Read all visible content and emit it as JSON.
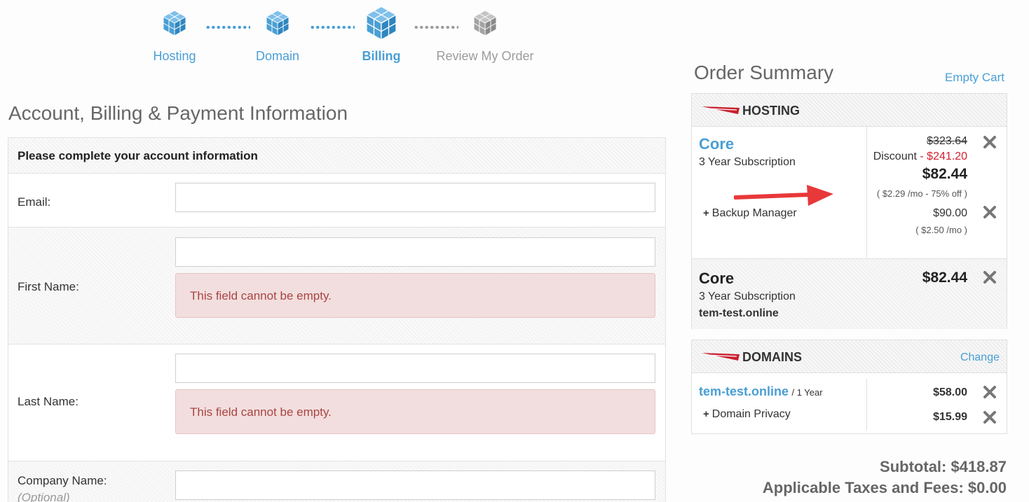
{
  "steps": [
    {
      "label": "Hosting",
      "state": "done"
    },
    {
      "label": "Domain",
      "state": "done"
    },
    {
      "label": "Billing",
      "state": "active"
    },
    {
      "label": "Review My Order",
      "state": "inactive"
    }
  ],
  "form": {
    "title": "Account, Billing & Payment Information",
    "panel_heading": "Please complete your account information",
    "fields": {
      "email": {
        "label": "Email:",
        "value": ""
      },
      "first_name": {
        "label": "First Name:",
        "value": "",
        "error": "This field cannot be empty."
      },
      "last_name": {
        "label": "Last Name:",
        "value": "",
        "error": "This field cannot be empty."
      },
      "company": {
        "label": "Company Name:",
        "hint": "(Optional)",
        "value": ""
      }
    }
  },
  "summary": {
    "title": "Order Summary",
    "empty_cart": "Empty Cart",
    "hosting": {
      "heading": "HOSTING",
      "plan": {
        "name": "Core",
        "term": "3 Year Subscription",
        "original_price": "$323.64",
        "discount_label": "Discount",
        "discount_amount": "- $241.20",
        "price": "$82.44",
        "price_note": "( $2.29 /mo - 75% off )"
      },
      "addon": {
        "name": "Backup Manager",
        "price": "$90.00",
        "price_note": "( $2.50 /mo )"
      },
      "plan2": {
        "name": "Core",
        "term": "3 Year Subscription",
        "domain": "tem-test.online",
        "price": "$82.44"
      }
    },
    "domains": {
      "heading": "DOMAINS",
      "change": "Change",
      "domain": {
        "name": "tem-test.online",
        "term": "/ 1 Year",
        "price": "$58.00"
      },
      "addon": {
        "name": "Domain Privacy",
        "price": "$15.99"
      }
    },
    "subtotal": "Subtotal: $418.87",
    "taxes": "Applicable Taxes and Fees: $0.00"
  },
  "colors": {
    "accent": "#4a9fd4",
    "error_bg": "#f2dede",
    "error_text": "#a94442",
    "discount": "#d3202f",
    "brand_red": "#c8202f",
    "arrow": "#e8383a"
  }
}
